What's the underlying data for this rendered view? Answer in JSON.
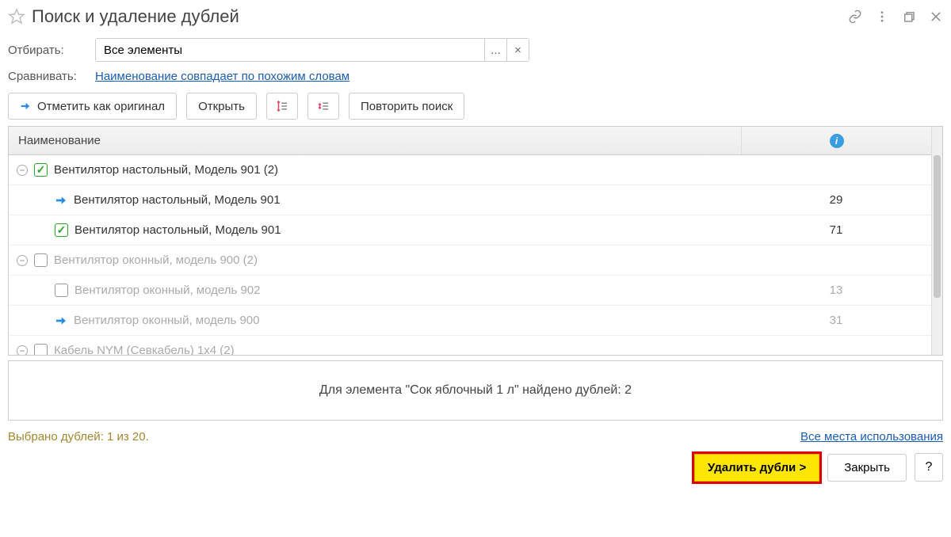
{
  "header": {
    "title": "Поиск и удаление дублей"
  },
  "form": {
    "filter_label": "Отбирать:",
    "filter_value": "Все элементы",
    "filter_more": "...",
    "filter_clear": "×",
    "compare_label": "Сравнивать:",
    "compare_value": "Наименование совпадает по похожим словам"
  },
  "toolbar": {
    "mark_original": "Отметить как оригинал",
    "open": "Открыть",
    "repeat_search": "Повторить поиск"
  },
  "table": {
    "column_name": "Наименование",
    "rows": [
      {
        "type": "group",
        "checked": true,
        "dim": false,
        "label": "Вентилятор настольный, Модель 901 (2)",
        "info": ""
      },
      {
        "type": "child",
        "marker": "arrow",
        "dim": false,
        "label": "Вентилятор настольный, Модель 901",
        "info": "29"
      },
      {
        "type": "child",
        "marker": "check",
        "dim": false,
        "label": "Вентилятор настольный, Модель 901",
        "info": "71"
      },
      {
        "type": "group",
        "checked": false,
        "dim": true,
        "label": "Вентилятор оконный, модель 900 (2)",
        "info": ""
      },
      {
        "type": "child",
        "marker": "box",
        "dim": true,
        "label": "Вентилятор оконный, модель 902",
        "info": "13"
      },
      {
        "type": "child",
        "marker": "arrow",
        "dim": true,
        "label": "Вентилятор оконный, модель 900",
        "info": "31"
      },
      {
        "type": "group",
        "checked": false,
        "dim": true,
        "label": "Кабель NYM (Севкабель) 1х4 (2)",
        "info": ""
      }
    ]
  },
  "status": {
    "message": "Для элемента \"Сок яблочный 1 л\" найдено дублей: 2"
  },
  "footer": {
    "selected": "Выбрано дублей: 1 из 20.",
    "all_usages": "Все места использования",
    "delete": "Удалить дубли >",
    "close": "Закрыть",
    "help": "?"
  }
}
